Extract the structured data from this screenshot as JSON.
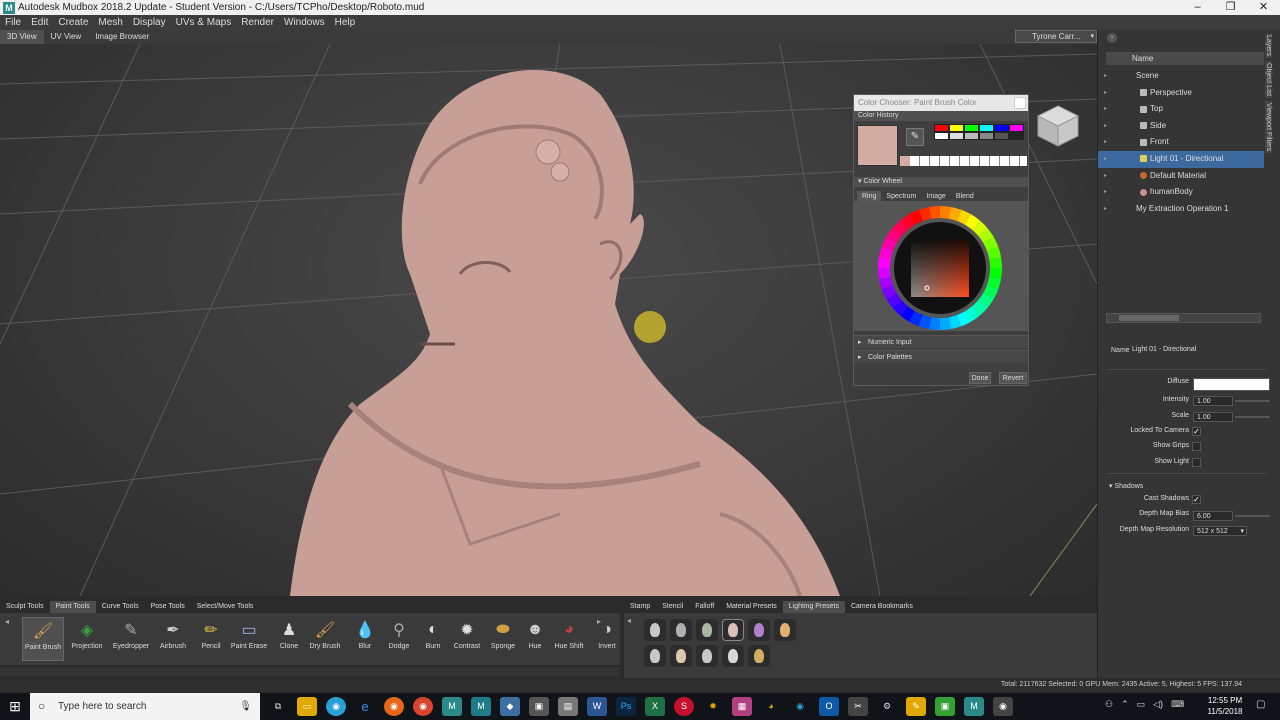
{
  "window": {
    "title": "Autodesk Mudbox 2018.2 Update - Student Version - C:/Users/TCPho/Desktop/Roboto.mud",
    "app_icon": "M",
    "controls": [
      "–",
      "❐",
      "✕"
    ]
  },
  "menu": [
    "File",
    "Edit",
    "Create",
    "Mesh",
    "Display",
    "UVs & Maps",
    "Render",
    "Windows",
    "Help"
  ],
  "view_tabs": [
    "3D View",
    "UV View",
    "Image Browser"
  ],
  "user": "Tyrone Carr...",
  "color_dialog": {
    "title": "Color Chooser: Paint Brush Color",
    "history_label": "Color History",
    "wheel_label": "Color Wheel",
    "wheel_tabs": [
      "Ring",
      "Spectrum",
      "Image",
      "Blend"
    ],
    "numeric_input": "Numeric Input",
    "color_palettes": "Color Palettes",
    "done": "Done",
    "revert": "Revert",
    "current_color": "#d3aca4",
    "history_colors": [
      "#ff0000",
      "#ffff00",
      "#00ff00",
      "#00ffff",
      "#0000ff",
      "#ff00ff",
      "#ffffff",
      "#dddddd",
      "#bbbbbb",
      "#888888",
      "#555555",
      "#222222"
    ]
  },
  "outliner": {
    "header": "Name",
    "items": [
      {
        "label": "Scene",
        "indent": 0,
        "icon": "none"
      },
      {
        "label": "Perspective",
        "indent": 1,
        "icon": "camera"
      },
      {
        "label": "Top",
        "indent": 1,
        "icon": "camera"
      },
      {
        "label": "Side",
        "indent": 1,
        "icon": "camera"
      },
      {
        "label": "Front",
        "indent": 1,
        "icon": "camera"
      },
      {
        "label": "Light 01 - Directional",
        "indent": 1,
        "icon": "light",
        "selected": true
      },
      {
        "label": "Default Material",
        "indent": 1,
        "icon": "material"
      },
      {
        "label": "humanBody",
        "indent": 1,
        "icon": "mesh"
      },
      {
        "label": "My Extraction Operation 1",
        "indent": 0,
        "icon": "none"
      }
    ],
    "side_tabs": [
      "Layers",
      "Object List",
      "Viewport Filters"
    ]
  },
  "properties": {
    "name_label": "Name",
    "name_value": "Light 01 - Directional",
    "diffuse": "Diffuse",
    "intensity_label": "Intensity",
    "intensity": "1.00",
    "scale_label": "Scale",
    "scale": "1.00",
    "locked_to_camera": "Locked To Camera",
    "show_grips": "Show Grips",
    "show_light": "Show Light",
    "shadows": "Shadows",
    "cast_shadows": "Cast Shadows",
    "depth_map_bias_label": "Depth Map Bias",
    "depth_map_bias": "6.00",
    "depth_map_res_label": "Depth Map Resolution",
    "depth_map_res": "512 x 512"
  },
  "tool_tabs": [
    "Sculpt Tools",
    "Paint Tools",
    "Curve Tools",
    "Pose Tools",
    "Select/Move Tools"
  ],
  "tools": [
    {
      "label": "Paint Brush",
      "icon": "brush-icon",
      "glyph": "🖌"
    },
    {
      "label": "Projection",
      "icon": "projection-icon",
      "glyph": "◈"
    },
    {
      "label": "Eyedropper",
      "icon": "eyedropper-icon",
      "glyph": "✎"
    },
    {
      "label": "Airbrush",
      "icon": "airbrush-icon",
      "glyph": "✒"
    },
    {
      "label": "Pencil",
      "icon": "pencil-icon",
      "glyph": "✏"
    },
    {
      "label": "Paint Erase",
      "icon": "eraser-icon",
      "glyph": "▭"
    },
    {
      "label": "Clone",
      "icon": "clone-icon",
      "glyph": "♟"
    },
    {
      "label": "Dry Brush",
      "icon": "dry-brush-icon",
      "glyph": "🖌"
    },
    {
      "label": "Blur",
      "icon": "blur-icon",
      "glyph": "💧"
    },
    {
      "label": "Dodge",
      "icon": "dodge-icon",
      "glyph": "⚲"
    },
    {
      "label": "Burn",
      "icon": "burn-icon",
      "glyph": "◐"
    },
    {
      "label": "Contrast",
      "icon": "contrast-icon",
      "glyph": "✹"
    },
    {
      "label": "Sponge",
      "icon": "sponge-icon",
      "glyph": "⬬"
    },
    {
      "label": "Hue",
      "icon": "hue-icon",
      "glyph": "☻"
    },
    {
      "label": "Hue Shift",
      "icon": "hue-shift-icon",
      "glyph": "◕"
    },
    {
      "label": "Invert",
      "icon": "invert-icon",
      "glyph": "◑"
    }
  ],
  "stamp_tabs": [
    "Stamp",
    "Stencil",
    "Falloff",
    "Material Presets",
    "Lighting Presets",
    "Camera Bookmarks"
  ],
  "status": "Total: 2117632  Selected: 0 GPU Mem: 2435  Active: 5, Highest: 5  FPS: 137.94",
  "taskbar": {
    "search_placeholder": "Type here to search",
    "time": "12:55 PM",
    "date": "11/5/2018"
  }
}
